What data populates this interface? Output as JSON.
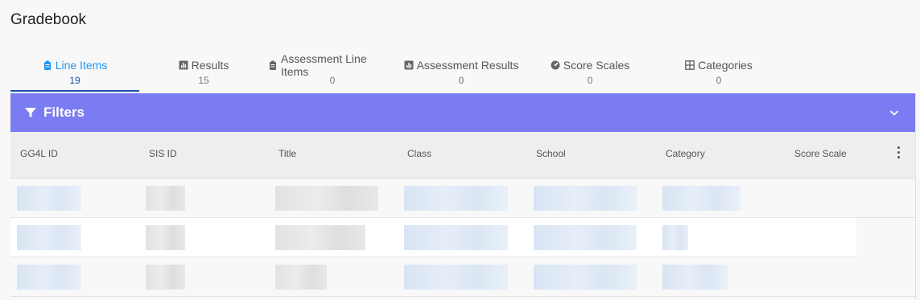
{
  "page": {
    "title": "Gradebook"
  },
  "tabs": [
    {
      "label": "Line Items",
      "count": "19",
      "icon": "clipboard-icon",
      "active": true
    },
    {
      "label": "Results",
      "count": "15",
      "icon": "bar-chart-icon",
      "active": false
    },
    {
      "label": "Assessment Line Items",
      "count": "0",
      "icon": "clipboard-icon",
      "active": false
    },
    {
      "label": "Assessment Results",
      "count": "0",
      "icon": "bar-chart-icon",
      "active": false
    },
    {
      "label": "Score Scales",
      "count": "0",
      "icon": "gauge-icon",
      "active": false
    },
    {
      "label": "Categories",
      "count": "0",
      "icon": "grid-icon",
      "active": false
    }
  ],
  "filters": {
    "label": "Filters",
    "icon": "funnel-icon",
    "expand_icon": "chevron-down-icon"
  },
  "table": {
    "columns": [
      "GG4L ID",
      "SIS ID",
      "Title",
      "Class",
      "School",
      "Category",
      "Score Scale"
    ],
    "menu_icon": "more-vert-icon",
    "rows_note": "",
    "row_count": 3
  },
  "colors": {
    "filters_bar": "#7c7cf2",
    "active_tab": "#2196f3",
    "active_underline": "#1a56a8"
  }
}
